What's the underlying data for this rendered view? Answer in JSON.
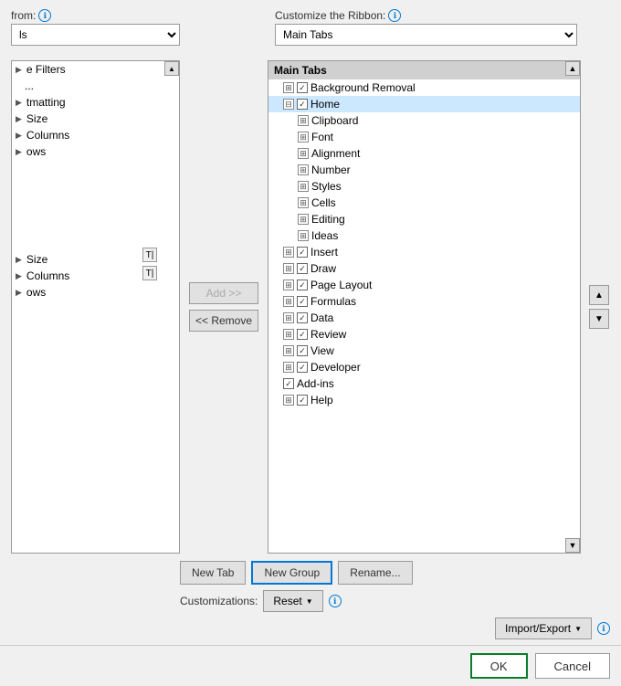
{
  "header": {
    "from_label": "from:",
    "from_info": "ℹ",
    "from_value": "ls",
    "customize_label": "Customize the Ribbon:",
    "customize_info": "ℹ",
    "customize_value": "Main Tabs"
  },
  "left_panel": {
    "scroll_up": "▲",
    "scroll_down": "▼",
    "items": [
      "e Filters",
      "...",
      "tmatting",
      "Size",
      "Columns",
      "ows",
      "Size",
      "Columns",
      "ows"
    ]
  },
  "middle": {
    "add_label": "Add >>",
    "remove_label": "<< Remove"
  },
  "right_panel": {
    "title": "Main Tabs",
    "items": [
      {
        "id": "background-removal",
        "label": "Background Removal",
        "indent": 1,
        "checked": true,
        "expandable": true
      },
      {
        "id": "home",
        "label": "Home",
        "indent": 1,
        "checked": true,
        "expandable": true,
        "selected": true
      },
      {
        "id": "clipboard",
        "label": "Clipboard",
        "indent": 2,
        "checked": false,
        "expandable": true
      },
      {
        "id": "font",
        "label": "Font",
        "indent": 2,
        "checked": false,
        "expandable": true
      },
      {
        "id": "alignment",
        "label": "Alignment",
        "indent": 2,
        "checked": false,
        "expandable": true
      },
      {
        "id": "number",
        "label": "Number",
        "indent": 2,
        "checked": false,
        "expandable": true
      },
      {
        "id": "styles",
        "label": "Styles",
        "indent": 2,
        "checked": false,
        "expandable": true
      },
      {
        "id": "cells",
        "label": "Cells",
        "indent": 2,
        "checked": false,
        "expandable": true
      },
      {
        "id": "editing",
        "label": "Editing",
        "indent": 2,
        "checked": false,
        "expandable": true
      },
      {
        "id": "ideas",
        "label": "Ideas",
        "indent": 2,
        "checked": false,
        "expandable": true
      },
      {
        "id": "insert",
        "label": "Insert",
        "indent": 1,
        "checked": true,
        "expandable": true
      },
      {
        "id": "draw",
        "label": "Draw",
        "indent": 1,
        "checked": true,
        "expandable": true
      },
      {
        "id": "page-layout",
        "label": "Page Layout",
        "indent": 1,
        "checked": true,
        "expandable": true
      },
      {
        "id": "formulas",
        "label": "Formulas",
        "indent": 1,
        "checked": true,
        "expandable": true
      },
      {
        "id": "data",
        "label": "Data",
        "indent": 1,
        "checked": true,
        "expandable": true
      },
      {
        "id": "review",
        "label": "Review",
        "indent": 1,
        "checked": true,
        "expandable": true
      },
      {
        "id": "view",
        "label": "View",
        "indent": 1,
        "checked": true,
        "expandable": true
      },
      {
        "id": "developer",
        "label": "Developer",
        "indent": 1,
        "checked": true,
        "expandable": true
      },
      {
        "id": "add-ins",
        "label": "Add-ins",
        "indent": 1,
        "checked": true,
        "expandable": false
      },
      {
        "id": "help",
        "label": "Help",
        "indent": 1,
        "checked": true,
        "expandable": true
      }
    ]
  },
  "arrows": {
    "up": "▲",
    "down": "▼"
  },
  "bottom": {
    "new_tab_label": "New Tab",
    "new_group_label": "New Group",
    "rename_label": "Rename...",
    "customizations_label": "Customizations:",
    "reset_label": "Reset",
    "reset_arrow": "▼",
    "info": "ℹ",
    "import_export_label": "Import/Export",
    "import_export_arrow": "▼"
  },
  "footer": {
    "ok_label": "OK",
    "cancel_label": "Cancel"
  },
  "separator_icons": [
    "T|",
    "T|"
  ]
}
